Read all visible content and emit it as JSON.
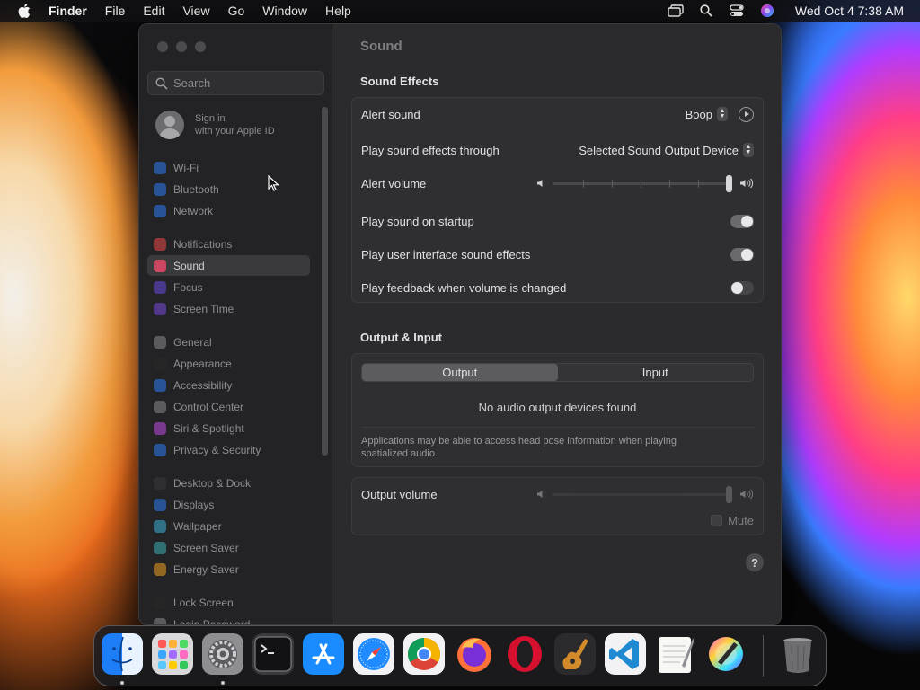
{
  "menubar": {
    "app_name": "Finder",
    "menus": [
      "File",
      "Edit",
      "View",
      "Go",
      "Window",
      "Help"
    ],
    "clock": "Wed Oct 4  7:38 AM",
    "tray_icons": [
      "screen-mirroring-icon",
      "search-icon",
      "control-center-icon",
      "siri-icon"
    ]
  },
  "window": {
    "title": "Sound",
    "search": {
      "placeholder": "Search"
    },
    "apple_id": {
      "line1": "Sign in",
      "line2": "with your Apple ID"
    },
    "sidebar": {
      "items": [
        {
          "label": "Wi-Fi",
          "icon": "wifi-icon",
          "color": "#2f7cf6"
        },
        {
          "label": "Bluetooth",
          "icon": "bluetooth-icon",
          "color": "#2f7cf6"
        },
        {
          "label": "Network",
          "icon": "network-icon",
          "color": "#2f7cf6"
        },
        {
          "label": "Notifications",
          "icon": "notifications-icon",
          "color": "#ef4a4a"
        },
        {
          "label": "Sound",
          "icon": "sound-icon",
          "color": "#ef4a6a"
        },
        {
          "label": "Focus",
          "icon": "focus-icon",
          "color": "#6a4ae0"
        },
        {
          "label": "Screen Time",
          "icon": "screen-time-icon",
          "color": "#7a4ae0"
        },
        {
          "label": "General",
          "icon": "general-icon",
          "color": "#8a8a8c"
        },
        {
          "label": "Appearance",
          "icon": "appearance-icon",
          "color": "#2a2a2a"
        },
        {
          "label": "Accessibility",
          "icon": "accessibility-icon",
          "color": "#2f7cf6"
        },
        {
          "label": "Control Center",
          "icon": "control-center-icon",
          "color": "#8a8a8c"
        },
        {
          "label": "Siri & Spotlight",
          "icon": "siri-icon",
          "color": "#c04ae0"
        },
        {
          "label": "Privacy & Security",
          "icon": "privacy-icon",
          "color": "#2f7cf6"
        },
        {
          "label": "Desktop & Dock",
          "icon": "desktop-dock-icon",
          "color": "#3a3a3c"
        },
        {
          "label": "Displays",
          "icon": "displays-icon",
          "color": "#2f7cf6"
        },
        {
          "label": "Wallpaper",
          "icon": "wallpaper-icon",
          "color": "#3ab0d8"
        },
        {
          "label": "Screen Saver",
          "icon": "screen-saver-icon",
          "color": "#3ab0b8"
        },
        {
          "label": "Energy Saver",
          "icon": "energy-saver-icon",
          "color": "#f0a020"
        },
        {
          "label": "Lock Screen",
          "icon": "lock-screen-icon",
          "color": "#2a2a2a"
        },
        {
          "label": "Login Password",
          "icon": "login-password-icon",
          "color": "#8a8a8c"
        }
      ],
      "selected": "Sound"
    },
    "sound_effects": {
      "section_title": "Sound Effects",
      "alert_sound_label": "Alert sound",
      "alert_sound_value": "Boop",
      "play_through_label": "Play sound effects through",
      "play_through_value": "Selected Sound Output Device",
      "alert_volume_label": "Alert volume",
      "alert_volume_level": 1.0,
      "startup_label": "Play sound on startup",
      "startup_on": true,
      "ui_effects_label": "Play user interface sound effects",
      "ui_effects_on": true,
      "feedback_label": "Play feedback when volume is changed",
      "feedback_on": false
    },
    "output_input": {
      "section_title": "Output & Input",
      "tabs": [
        "Output",
        "Input"
      ],
      "active_tab": "Output",
      "empty_message": "No audio output devices found",
      "note": "Applications may be able to access head pose information when playing spatialized audio."
    },
    "output_volume": {
      "label": "Output volume",
      "level": 1.0,
      "mute_label": "Mute",
      "muted": false
    },
    "help_label": "?"
  },
  "dock": {
    "apps": [
      {
        "name": "Finder",
        "icon": "finder-icon",
        "running": true
      },
      {
        "name": "Launchpad",
        "icon": "launchpad-icon",
        "running": false
      },
      {
        "name": "System Settings",
        "icon": "system-settings-icon",
        "running": true
      },
      {
        "name": "Terminal",
        "icon": "terminal-icon",
        "running": false
      },
      {
        "name": "App Store",
        "icon": "app-store-icon",
        "running": false
      },
      {
        "name": "Safari",
        "icon": "safari-icon",
        "running": false
      },
      {
        "name": "Chrome",
        "icon": "chrome-icon",
        "running": false
      },
      {
        "name": "Firefox",
        "icon": "firefox-icon",
        "running": false
      },
      {
        "name": "Opera",
        "icon": "opera-icon",
        "running": false
      },
      {
        "name": "GarageBand",
        "icon": "garageband-icon",
        "running": false
      },
      {
        "name": "VS Code",
        "icon": "vscode-icon",
        "running": false
      },
      {
        "name": "TextEdit",
        "icon": "textedit-icon",
        "running": false
      },
      {
        "name": "Color Picker",
        "icon": "color-picker-icon",
        "running": false
      },
      {
        "name": "Trash",
        "icon": "trash-icon",
        "running": false
      }
    ]
  }
}
